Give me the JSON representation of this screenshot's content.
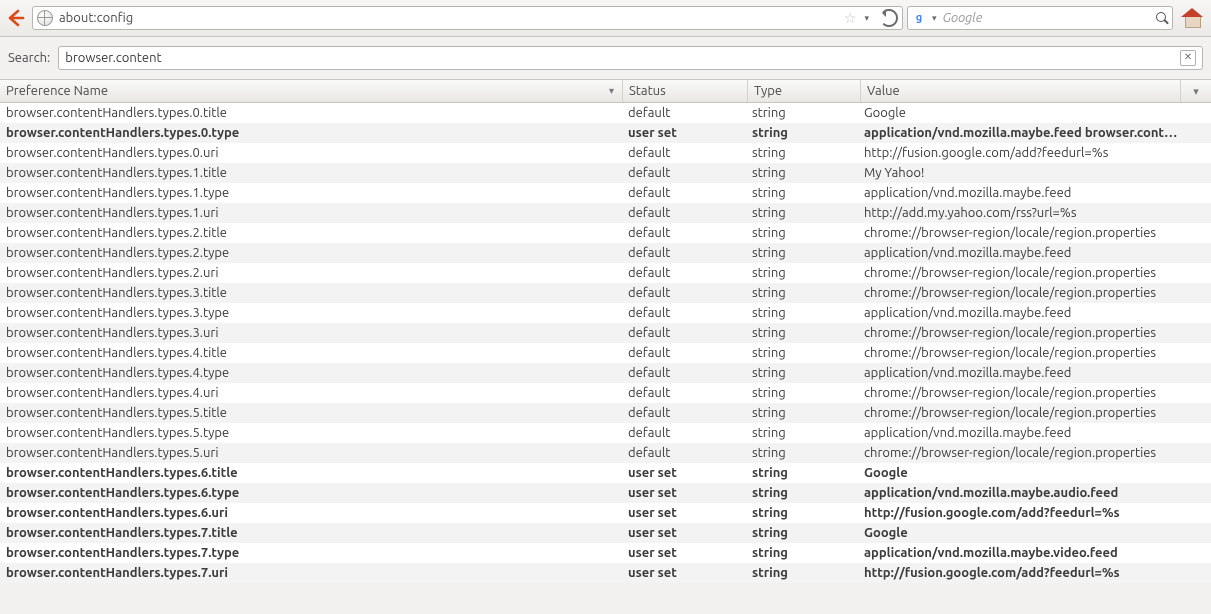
{
  "toolbar": {
    "url": "about:config",
    "search_placeholder": "Google"
  },
  "search": {
    "label": "Search:",
    "value": "browser.content"
  },
  "columns": {
    "name": "Preference Name",
    "status": "Status",
    "type": "Type",
    "value": "Value"
  },
  "rows": [
    {
      "name": "browser.contentHandlers.types.0.title",
      "status": "default",
      "type": "string",
      "value": "Google",
      "userset": false
    },
    {
      "name": "browser.contentHandlers.types.0.type",
      "status": "user set",
      "type": "string",
      "value": "application/vnd.mozilla.maybe.feed browser.cont…",
      "userset": true
    },
    {
      "name": "browser.contentHandlers.types.0.uri",
      "status": "default",
      "type": "string",
      "value": "http://fusion.google.com/add?feedurl=%s",
      "userset": false
    },
    {
      "name": "browser.contentHandlers.types.1.title",
      "status": "default",
      "type": "string",
      "value": "My Yahoo!",
      "userset": false
    },
    {
      "name": "browser.contentHandlers.types.1.type",
      "status": "default",
      "type": "string",
      "value": "application/vnd.mozilla.maybe.feed",
      "userset": false
    },
    {
      "name": "browser.contentHandlers.types.1.uri",
      "status": "default",
      "type": "string",
      "value": "http://add.my.yahoo.com/rss?url=%s",
      "userset": false
    },
    {
      "name": "browser.contentHandlers.types.2.title",
      "status": "default",
      "type": "string",
      "value": "chrome://browser-region/locale/region.properties",
      "userset": false
    },
    {
      "name": "browser.contentHandlers.types.2.type",
      "status": "default",
      "type": "string",
      "value": "application/vnd.mozilla.maybe.feed",
      "userset": false
    },
    {
      "name": "browser.contentHandlers.types.2.uri",
      "status": "default",
      "type": "string",
      "value": "chrome://browser-region/locale/region.properties",
      "userset": false
    },
    {
      "name": "browser.contentHandlers.types.3.title",
      "status": "default",
      "type": "string",
      "value": "chrome://browser-region/locale/region.properties",
      "userset": false
    },
    {
      "name": "browser.contentHandlers.types.3.type",
      "status": "default",
      "type": "string",
      "value": "application/vnd.mozilla.maybe.feed",
      "userset": false
    },
    {
      "name": "browser.contentHandlers.types.3.uri",
      "status": "default",
      "type": "string",
      "value": "chrome://browser-region/locale/region.properties",
      "userset": false
    },
    {
      "name": "browser.contentHandlers.types.4.title",
      "status": "default",
      "type": "string",
      "value": "chrome://browser-region/locale/region.properties",
      "userset": false
    },
    {
      "name": "browser.contentHandlers.types.4.type",
      "status": "default",
      "type": "string",
      "value": "application/vnd.mozilla.maybe.feed",
      "userset": false
    },
    {
      "name": "browser.contentHandlers.types.4.uri",
      "status": "default",
      "type": "string",
      "value": "chrome://browser-region/locale/region.properties",
      "userset": false
    },
    {
      "name": "browser.contentHandlers.types.5.title",
      "status": "default",
      "type": "string",
      "value": "chrome://browser-region/locale/region.properties",
      "userset": false
    },
    {
      "name": "browser.contentHandlers.types.5.type",
      "status": "default",
      "type": "string",
      "value": "application/vnd.mozilla.maybe.feed",
      "userset": false
    },
    {
      "name": "browser.contentHandlers.types.5.uri",
      "status": "default",
      "type": "string",
      "value": "chrome://browser-region/locale/region.properties",
      "userset": false
    },
    {
      "name": "browser.contentHandlers.types.6.title",
      "status": "user set",
      "type": "string",
      "value": "Google",
      "userset": true
    },
    {
      "name": "browser.contentHandlers.types.6.type",
      "status": "user set",
      "type": "string",
      "value": "application/vnd.mozilla.maybe.audio.feed",
      "userset": true
    },
    {
      "name": "browser.contentHandlers.types.6.uri",
      "status": "user set",
      "type": "string",
      "value": "http://fusion.google.com/add?feedurl=%s",
      "userset": true
    },
    {
      "name": "browser.contentHandlers.types.7.title",
      "status": "user set",
      "type": "string",
      "value": "Google",
      "userset": true
    },
    {
      "name": "browser.contentHandlers.types.7.type",
      "status": "user set",
      "type": "string",
      "value": "application/vnd.mozilla.maybe.video.feed",
      "userset": true
    },
    {
      "name": "browser.contentHandlers.types.7.uri",
      "status": "user set",
      "type": "string",
      "value": "http://fusion.google.com/add?feedurl=%s",
      "userset": true
    }
  ]
}
